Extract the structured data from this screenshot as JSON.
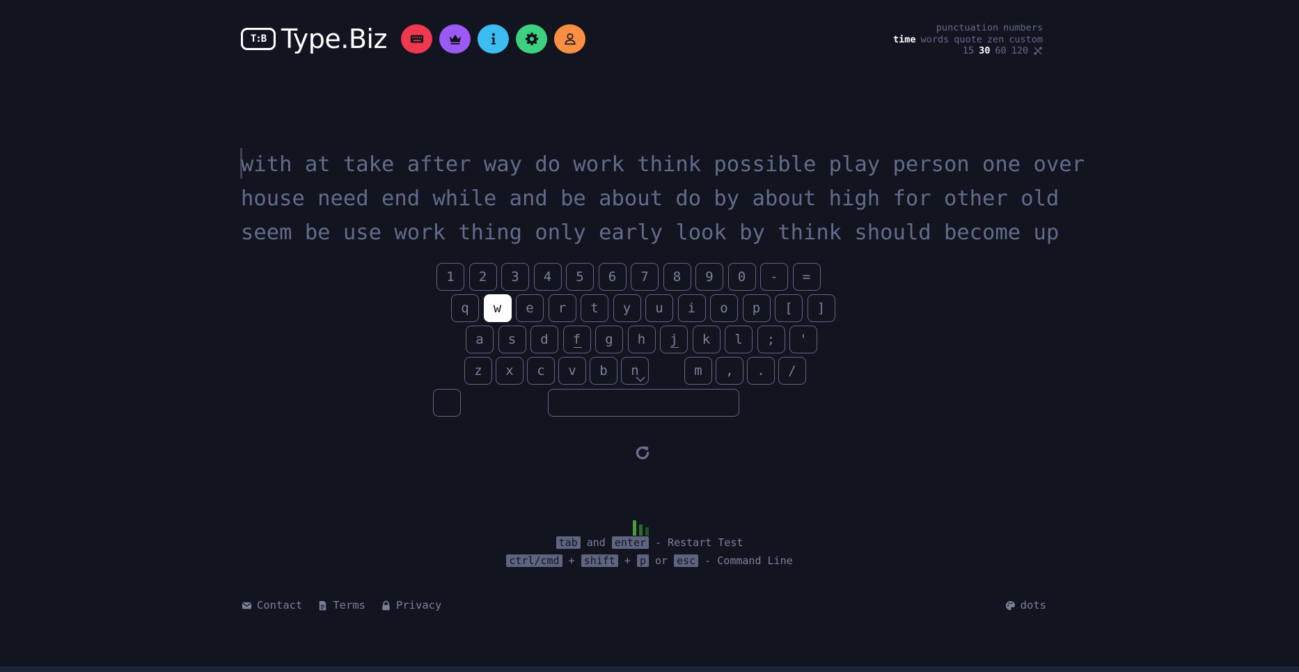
{
  "header": {
    "logo_mark": "T:B",
    "title": "Type.Biz",
    "nav": [
      {
        "icon": "keyboard-icon",
        "color": "#f0384f"
      },
      {
        "icon": "crown-icon",
        "color": "#9b59f5"
      },
      {
        "icon": "info-icon",
        "color": "#3bbdf1"
      },
      {
        "icon": "gear-icon",
        "color": "#3dd07f"
      },
      {
        "icon": "user-icon",
        "color": "#fd8f44"
      }
    ]
  },
  "config": {
    "toggles": [
      "punctuation",
      "numbers"
    ],
    "modes": [
      "time",
      "words",
      "quote",
      "zen",
      "custom"
    ],
    "active_mode": "time",
    "durations": [
      "15",
      "30",
      "60",
      "120"
    ],
    "active_duration": "30"
  },
  "words": {
    "line1": "with at take after way do work think possible play person one over",
    "line2": "house need end while and be about do by about high for other old",
    "line3": "seem be use work thing only early look by think should become up"
  },
  "keyboard": {
    "row1": [
      "1",
      "2",
      "3",
      "4",
      "5",
      "6",
      "7",
      "8",
      "9",
      "0",
      "-",
      "="
    ],
    "row2": [
      "q",
      "w",
      "e",
      "r",
      "t",
      "y",
      "u",
      "i",
      "o",
      "p",
      "[",
      "]"
    ],
    "row3": [
      "a",
      "s",
      "d",
      "f",
      "g",
      "h",
      "j",
      "k",
      "l",
      ";",
      "'"
    ],
    "row4": [
      "z",
      "x",
      "c",
      "v",
      "b",
      "n",
      "m",
      ",",
      ".",
      "/"
    ],
    "highlighted": "w"
  },
  "hints": {
    "line1": {
      "k1": "tab",
      "and": "and",
      "k2": "enter",
      "text": "- Restart Test"
    },
    "line2": {
      "k1": "ctrl/cmd",
      "plus1": "+",
      "k2": "shift",
      "plus2": "+",
      "k3": "p",
      "or": "or",
      "k4": "esc",
      "text": "- Command Line"
    }
  },
  "footer": {
    "contact": "Contact",
    "terms": "Terms",
    "privacy": "Privacy",
    "theme": "dots"
  },
  "colors": {
    "accent_bars": [
      "#4a9d3f",
      "#2f6b2a",
      "#254f22"
    ]
  }
}
